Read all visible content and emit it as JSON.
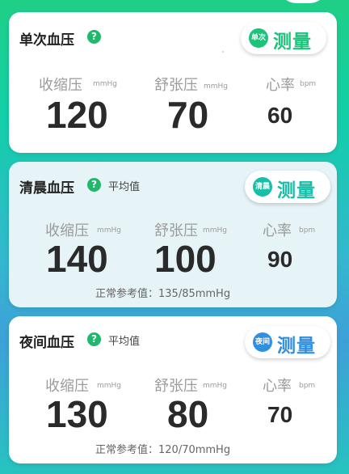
{
  "cards": [
    {
      "title": "单次血压",
      "measure_badge": "单次",
      "measure_label": "测量",
      "systolic_label": "收缩压",
      "diastolic_label": "舒张压",
      "hr_label": "心率",
      "unit_mmhg": "mmHg",
      "unit_bpm": "bpm",
      "systolic": "120",
      "diastolic": "70",
      "heart_rate": "60"
    },
    {
      "title": "清晨血压",
      "avg_label": "平均值",
      "measure_badge": "清晨",
      "measure_label": "测量",
      "systolic_label": "收缩压",
      "diastolic_label": "舒张压",
      "hr_label": "心率",
      "unit_mmhg": "mmHg",
      "unit_bpm": "bpm",
      "systolic": "140",
      "diastolic": "100",
      "heart_rate": "90",
      "reference": "正常参考值：135/85mmHg"
    },
    {
      "title": "夜间血压",
      "avg_label": "平均值",
      "measure_badge": "夜间",
      "measure_label": "测量",
      "systolic_label": "收缩压",
      "diastolic_label": "舒张压",
      "hr_label": "心率",
      "unit_mmhg": "mmHg",
      "unit_bpm": "bpm",
      "systolic": "130",
      "diastolic": "80",
      "heart_rate": "70",
      "reference": "正常参考值：120/70mmHg"
    }
  ],
  "help_glyph": "?",
  "colors": {
    "green": "#1cc47b",
    "teal": "#16bfa8",
    "blue": "#2f8fe0"
  }
}
